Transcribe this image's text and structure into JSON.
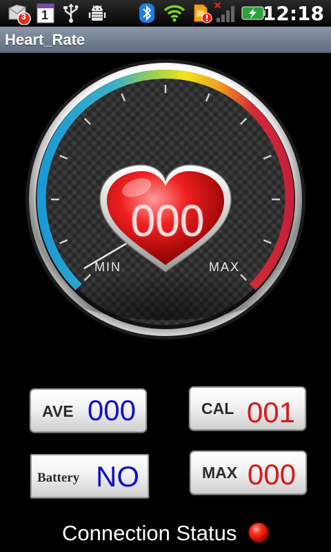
{
  "status_bar": {
    "notification_count": "3",
    "calendar_day": "1",
    "clock": "12:18",
    "icons": [
      "mail-notification-icon",
      "calendar-icon",
      "usb-icon",
      "android-debug-icon",
      "bluetooth-icon",
      "wifi-icon",
      "sim-alert-icon",
      "signal-icon",
      "battery-charging-icon"
    ]
  },
  "app": {
    "title": "Heart_Rate"
  },
  "gauge": {
    "heart_value": "000",
    "min_label": "MIN",
    "max_label": "MAX",
    "needle_level": 0
  },
  "stats": {
    "ave": {
      "label": "AVE",
      "value": "000",
      "color": "#1010c8"
    },
    "cal": {
      "label": "CAL",
      "value": "001",
      "color": "#d71818"
    },
    "battery": {
      "label": "Battery",
      "value": "NO",
      "color": "#1010c8"
    },
    "max": {
      "label": "MAX",
      "value": "000",
      "color": "#d71818"
    }
  },
  "connection": {
    "label": "Connection Status",
    "state_color": "#e01a0a"
  }
}
